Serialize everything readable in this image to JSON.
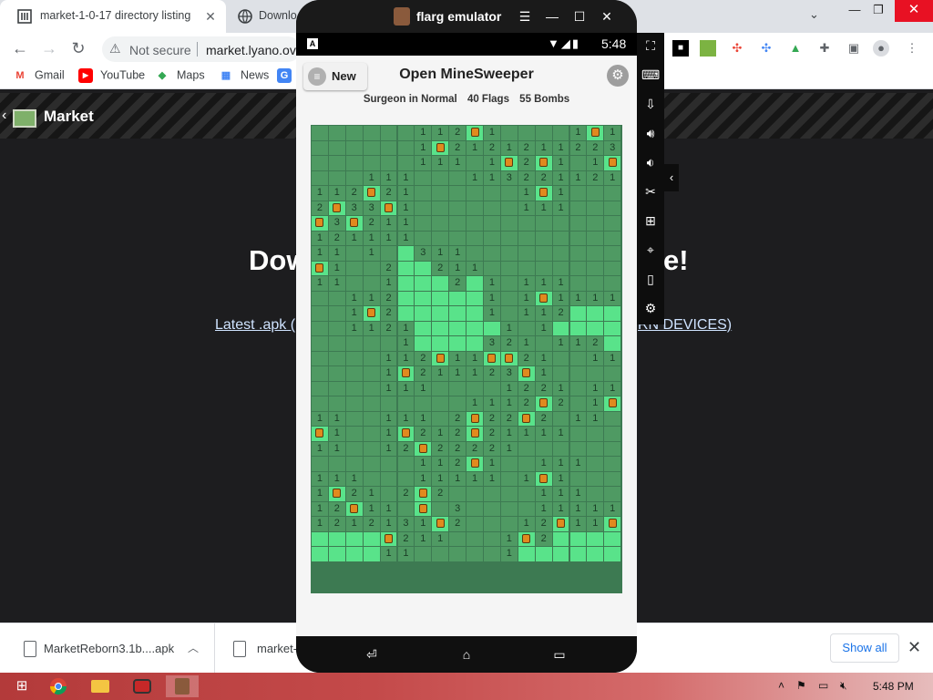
{
  "browser": {
    "tabs": [
      {
        "label": "market-1-0-17 directory listing"
      },
      {
        "label": "Downlo"
      }
    ],
    "omnibox": {
      "security": "Not secure",
      "url": "market.lyano.ov"
    },
    "bookmarks": [
      {
        "label": "Gmail",
        "icon": "gmail-icon"
      },
      {
        "label": "YouTube",
        "icon": "youtube-icon"
      },
      {
        "label": "Maps",
        "icon": "maps-icon"
      },
      {
        "label": "News",
        "icon": "news-icon"
      }
    ]
  },
  "page": {
    "header_title": "Market",
    "heading_left": "Dow",
    "heading_right": "e!",
    "link_left": "Latest .apk (",
    "link_right": "RN DEVICES)"
  },
  "downloads": {
    "item1": "MarketReborn3.1b....apk",
    "item2": "market-",
    "show_all": "Show all"
  },
  "taskbar": {
    "time": "5:48 PM"
  },
  "emulator": {
    "title": "flarg emulator",
    "status_time": "5:48",
    "status_badge": "A"
  },
  "game": {
    "new_label": "New",
    "title": "Open MineSweeper",
    "difficulty": "Surgeon in Normal",
    "flags": "40 Flags",
    "bombs": "55 Bombs",
    "cols": 18,
    "rows": 27,
    "colors": {
      "covered": "#4f9a63",
      "revealed": "#59e38a",
      "flag": "#59e38a",
      "text": "#1a1a1a"
    },
    "grid": [
      "hhhhhh112F1hhhh1F1",
      "hhhhhh1F212121122 31",
      "hhhhhh111h1F2F1h1F2F",
      "hhh111hhh113221121",
      "112F21hhhhhh1F1hhh",
      "2F33F1hhhhhh111hhh",
      "F3F211hhhhhhhhhhhh",
      "121111hhhhhhhhhhhh",
      "11h1h.311hhhhhhhhh",
      "F1hh2..211hhhhhhhh",
      "11hh1...2.1h111hhh",
      "hh112.....1h1F1111",
      "hh1F2.....1h112...",
      "hh1121.....1h1....",
      "hhhhh1....321h112.",
      "hhhh112F11FF21hh11",
      "hhhh1F21112 3F1hhhh",
      "hhhh111hhhh1221h11",
      "hhhhhhhhh1112F2h1F",
      "11hh111h2F22F2h11h",
      "F1hh1F212F21111hhh",
      "11hh12F22221hhhhhh",
      "hhhhhh112F1hh111hh",
      "111hhh11111h1F1hhh",
      "1F21h2F2hhhhh111hh",
      "12F11hFh3hhhh11111",
      "1212131F2hhh12F11F",
      "....F211hhh1F2....",
      "....11hhhhh1......"
    ]
  }
}
